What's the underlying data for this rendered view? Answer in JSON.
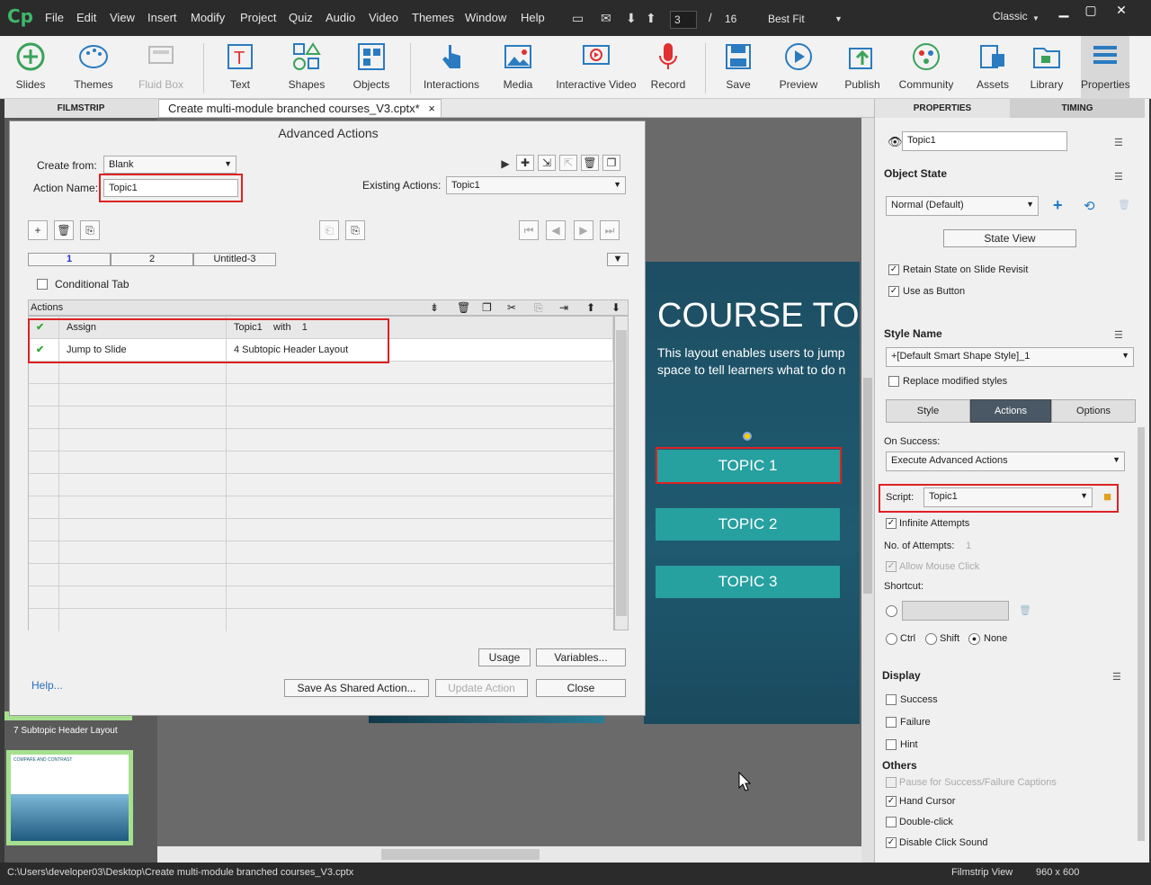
{
  "menubar": {
    "logo": "Cp",
    "items": [
      "File",
      "Edit",
      "View",
      "Insert",
      "Modify",
      "Project",
      "Quiz",
      "Audio",
      "Video",
      "Themes",
      "Window",
      "Help"
    ],
    "current_page": "3",
    "page_sep": "/",
    "total_pages": "16",
    "zoom": "Best Fit",
    "mode": "Classic"
  },
  "toolbar": {
    "items": [
      "Slides",
      "Themes",
      "Fluid Box",
      "Text",
      "Shapes",
      "Objects",
      "Interactions",
      "Media",
      "Interactive Video",
      "Record",
      "Save",
      "Preview",
      "Publish",
      "Community",
      "Assets",
      "Library",
      "Properties"
    ]
  },
  "tabs": {
    "filmstrip": "FILMSTRIP",
    "document": "Create multi-module branched courses_V3.cptx*",
    "close": "×"
  },
  "slide": {
    "title": "COURSE TOPICS",
    "subtitle_line1": "This layout enables users to jump",
    "subtitle_line2": "space to tell learners what to do n",
    "buttons": [
      "TOPIC 1",
      "TOPIC 2",
      "TOPIC 3"
    ]
  },
  "filmstrip": {
    "slide7_label": "7 Subtopic Header Layout",
    "slide8_title": "COMPARE AND CONTRAST"
  },
  "dialog": {
    "title": "Advanced Actions",
    "create_from_label": "Create from:",
    "create_from_value": "Blank",
    "action_name_label": "Action Name:",
    "action_name_value": "Topic1",
    "existing_label": "Existing Actions:",
    "existing_value": "Topic1",
    "tabs": [
      "1",
      "2",
      "Untitled-3"
    ],
    "conditional_label": "Conditional Tab",
    "actions_header": "Actions",
    "rows": [
      {
        "action": "Assign",
        "target": "Topic1    with    1"
      },
      {
        "action": "Jump to Slide",
        "target": "4 Subtopic Header Layout"
      }
    ],
    "usage": "Usage",
    "variables": "Variables...",
    "help": "Help...",
    "save_shared": "Save As Shared Action...",
    "update": "Update Action",
    "close": "Close"
  },
  "properties": {
    "tab_properties": "PROPERTIES",
    "tab_timing": "TIMING",
    "name_value": "Topic1",
    "object_state_label": "Object State",
    "state_value": "Normal (Default)",
    "state_view": "State View",
    "retain_state": "Retain State on Slide Revisit",
    "use_as_button": "Use as Button",
    "style_name_label": "Style Name",
    "style_value": "+[Default Smart Shape Style]_1",
    "replace_styles": "Replace modified styles",
    "subtabs": [
      "Style",
      "Actions",
      "Options"
    ],
    "on_success_label": "On Success:",
    "on_success_value": "Execute Advanced Actions",
    "script_label": "Script:",
    "script_value": "Topic1",
    "infinite_attempts": "Infinite Attempts",
    "num_attempts_label": "No. of Attempts:",
    "num_attempts_value": "1",
    "allow_mouse": "Allow Mouse Click",
    "shortcut_label": "Shortcut:",
    "ctrl": "Ctrl",
    "shift": "Shift",
    "none": "None",
    "display_label": "Display",
    "success": "Success",
    "failure": "Failure",
    "hint": "Hint",
    "others_label": "Others",
    "pause": "Pause for Success/Failure Captions",
    "hand_cursor": "Hand Cursor",
    "double_click": "Double-click",
    "disable_sound": "Disable Click Sound"
  },
  "status": {
    "path": "C:\\Users\\developer03\\Desktop\\Create multi-module branched courses_V3.cptx",
    "view": "Filmstrip View",
    "size": "960 x 600"
  }
}
